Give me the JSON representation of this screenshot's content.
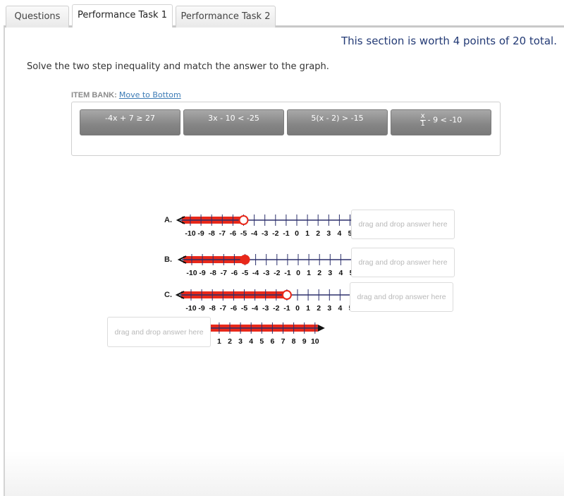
{
  "tabs": [
    {
      "label": "Questions",
      "active": false
    },
    {
      "label": "Performance Task 1",
      "active": true
    },
    {
      "label": "Performance Task 2",
      "active": false
    }
  ],
  "section_worth": "This section is worth 4 points of 20 total.",
  "instructions": "Solve the two step inequality and match the answer to the graph.",
  "item_bank": {
    "label": "ITEM BANK:",
    "move_link": "Move to Bottom",
    "items": [
      {
        "text": "-4x + 7 ≥ 27"
      },
      {
        "text": "3x - 10 < -25"
      },
      {
        "text": "5(x - 2) > -15"
      },
      {
        "fraction_num": "x",
        "fraction_den": "1",
        "text": "- 9 < -10"
      }
    ]
  },
  "drop_placeholder": "drag and drop answer here",
  "number_lines": [
    {
      "label": "A.",
      "min": -10,
      "max": 5,
      "point": -5,
      "closed": false,
      "direction": "left"
    },
    {
      "label": "B.",
      "min": -10,
      "max": 5,
      "point": -5,
      "closed": true,
      "direction": "left"
    },
    {
      "label": "C.",
      "min": -10,
      "max": 5,
      "point": -1,
      "closed": false,
      "direction": "left"
    },
    {
      "label": "",
      "min": -8,
      "max": 10,
      "point": -1,
      "closed": false,
      "direction": "right"
    }
  ],
  "colors": {
    "line": "#2b2f6b",
    "shade": "#e8281a",
    "title_blue": "#233a75",
    "link": "#3b7ab5"
  }
}
